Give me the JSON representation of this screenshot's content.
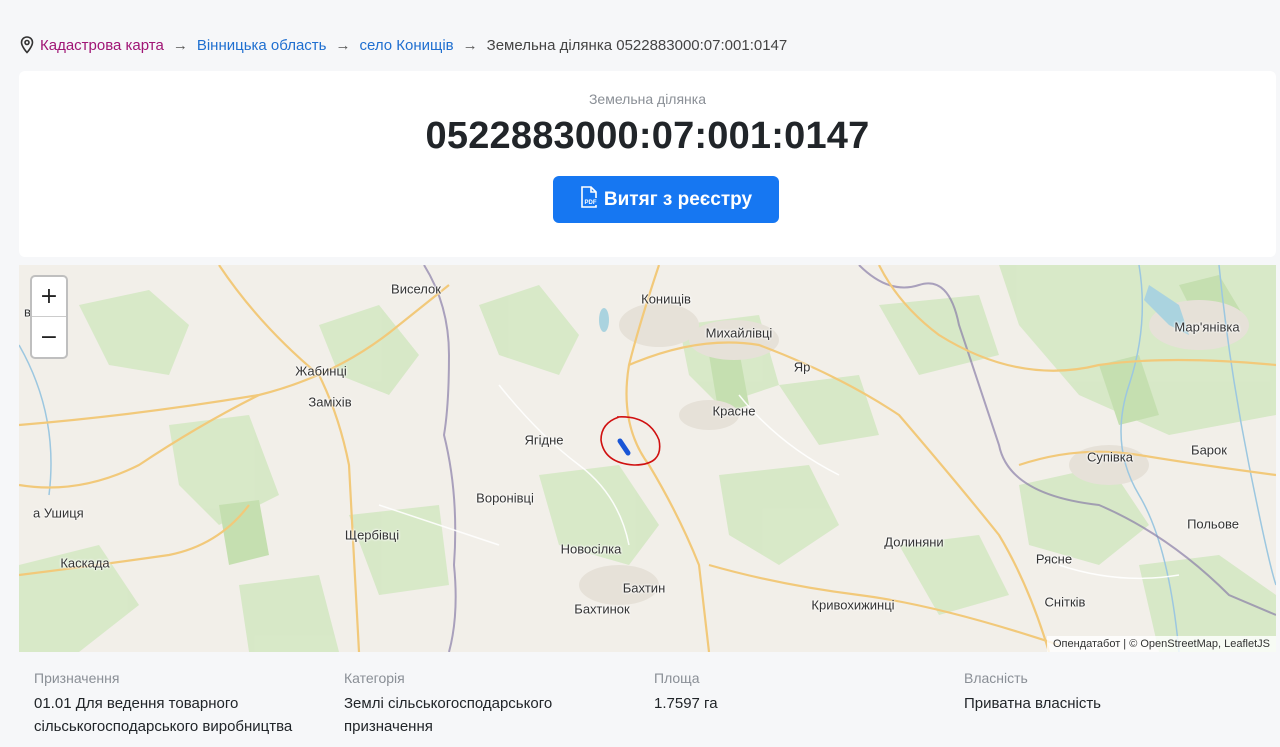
{
  "breadcrumb": {
    "root": "Кадастрова карта",
    "region": "Вінницька область",
    "village": "село Конищів",
    "current": "Земельна ділянка 0522883000:07:001:0147",
    "separator": "→"
  },
  "parcel": {
    "label": "Земельна ділянка",
    "number": "0522883000:07:001:0147",
    "extract_button": "Витяг з реєстру",
    "pdf_icon_text": "PDF"
  },
  "map": {
    "zoom_in": "+",
    "zoom_out": "−",
    "attribution": "Опендатабот | © OpenStreetMap, LeafletJS",
    "places": [
      {
        "name": "Виселок"
      },
      {
        "name": "Конищів"
      },
      {
        "name": "Михайлівці"
      },
      {
        "name": "Мар'янівка"
      },
      {
        "name": "Жабинці"
      },
      {
        "name": "Заміхів"
      },
      {
        "name": "Яр"
      },
      {
        "name": "Красне"
      },
      {
        "name": "Ягідне"
      },
      {
        "name": "Супівка"
      },
      {
        "name": "Барок"
      },
      {
        "name": "Воронівці"
      },
      {
        "name": "а Ушиця"
      },
      {
        "name": "Польове"
      },
      {
        "name": "Щербівці"
      },
      {
        "name": "Долиняни"
      },
      {
        "name": "Новосілка"
      },
      {
        "name": "Каскада"
      },
      {
        "name": "Рясне"
      },
      {
        "name": "Бахтин"
      },
      {
        "name": "Бахтинок"
      },
      {
        "name": "Кривохижинці"
      },
      {
        "name": "Сніткiв"
      },
      {
        "name": "вк"
      }
    ]
  },
  "info": {
    "purpose_label": "Призначення",
    "purpose_value": "01.01 Для ведення товарного сільськогосподарського виробництва",
    "category_label": "Категорія",
    "category_value": "Землі сільськогосподарського призначення",
    "area_label": "Площа",
    "area_value": "1.7597 га",
    "ownership_label": "Власність",
    "ownership_value": "Приватна власність"
  },
  "colors": {
    "accent": "#1677f2",
    "breadcrumb_root": "#a01575",
    "breadcrumb_link": "#1f6fd0",
    "parcel_marker": "#1a56d6",
    "highlight_circle": "#d01010"
  }
}
